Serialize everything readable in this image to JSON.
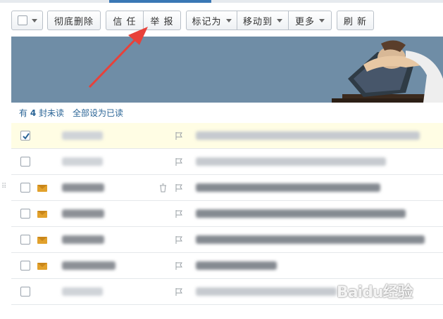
{
  "toolbar": {
    "select_all_caret": "select-dropdown",
    "delete_label": "彻底删除",
    "trust_label": "信 任",
    "report_label": "举 报",
    "mark_as_label": "标记为",
    "move_to_label": "移动到",
    "more_label": "更多",
    "refresh_label": "刷 新"
  },
  "unread_bar": {
    "prefix": "有",
    "count": "4",
    "suffix": "封未读",
    "mark_all_label": "全部设为已读"
  },
  "mail_rows": [
    {
      "checked": true,
      "unread": false,
      "has_trash": false
    },
    {
      "checked": false,
      "unread": false,
      "has_trash": false
    },
    {
      "checked": false,
      "unread": true,
      "has_trash": true
    },
    {
      "checked": false,
      "unread": true,
      "has_trash": false
    },
    {
      "checked": false,
      "unread": true,
      "has_trash": false
    },
    {
      "checked": false,
      "unread": true,
      "has_trash": false
    },
    {
      "checked": false,
      "unread": false,
      "has_trash": false
    }
  ],
  "watermark": {
    "brand": "Baidu经验"
  },
  "colors": {
    "accent": "#3a78b5",
    "banner": "#6f8da6",
    "unread_envelope": "#e2a12c",
    "selected_row": "#fffde4",
    "annotation_arrow": "#e8413a"
  },
  "icons": [
    "checkbox-icon",
    "flag-icon",
    "envelope-icon",
    "trash-icon",
    "checkmark-icon"
  ]
}
